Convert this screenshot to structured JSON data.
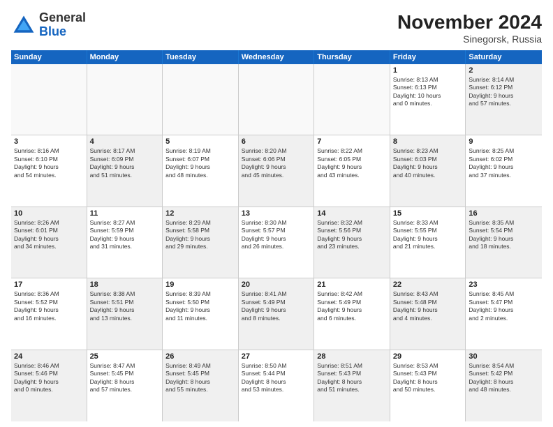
{
  "logo": {
    "general": "General",
    "blue": "Blue"
  },
  "title": "November 2024",
  "subtitle": "Sinegorsk, Russia",
  "header_days": [
    "Sunday",
    "Monday",
    "Tuesday",
    "Wednesday",
    "Thursday",
    "Friday",
    "Saturday"
  ],
  "rows": [
    [
      {
        "day": "",
        "empty": true
      },
      {
        "day": "",
        "empty": true
      },
      {
        "day": "",
        "empty": true
      },
      {
        "day": "",
        "empty": true
      },
      {
        "day": "",
        "empty": true
      },
      {
        "day": "1",
        "lines": [
          "Sunrise: 8:13 AM",
          "Sunset: 6:13 PM",
          "Daylight: 10 hours",
          "and 0 minutes."
        ]
      },
      {
        "day": "2",
        "shaded": true,
        "lines": [
          "Sunrise: 8:14 AM",
          "Sunset: 6:12 PM",
          "Daylight: 9 hours",
          "and 57 minutes."
        ]
      }
    ],
    [
      {
        "day": "3",
        "lines": [
          "Sunrise: 8:16 AM",
          "Sunset: 6:10 PM",
          "Daylight: 9 hours",
          "and 54 minutes."
        ]
      },
      {
        "day": "4",
        "shaded": true,
        "lines": [
          "Sunrise: 8:17 AM",
          "Sunset: 6:09 PM",
          "Daylight: 9 hours",
          "and 51 minutes."
        ]
      },
      {
        "day": "5",
        "lines": [
          "Sunrise: 8:19 AM",
          "Sunset: 6:07 PM",
          "Daylight: 9 hours",
          "and 48 minutes."
        ]
      },
      {
        "day": "6",
        "shaded": true,
        "lines": [
          "Sunrise: 8:20 AM",
          "Sunset: 6:06 PM",
          "Daylight: 9 hours",
          "and 45 minutes."
        ]
      },
      {
        "day": "7",
        "lines": [
          "Sunrise: 8:22 AM",
          "Sunset: 6:05 PM",
          "Daylight: 9 hours",
          "and 43 minutes."
        ]
      },
      {
        "day": "8",
        "shaded": true,
        "lines": [
          "Sunrise: 8:23 AM",
          "Sunset: 6:03 PM",
          "Daylight: 9 hours",
          "and 40 minutes."
        ]
      },
      {
        "day": "9",
        "lines": [
          "Sunrise: 8:25 AM",
          "Sunset: 6:02 PM",
          "Daylight: 9 hours",
          "and 37 minutes."
        ]
      }
    ],
    [
      {
        "day": "10",
        "shaded": true,
        "lines": [
          "Sunrise: 8:26 AM",
          "Sunset: 6:01 PM",
          "Daylight: 9 hours",
          "and 34 minutes."
        ]
      },
      {
        "day": "11",
        "lines": [
          "Sunrise: 8:27 AM",
          "Sunset: 5:59 PM",
          "Daylight: 9 hours",
          "and 31 minutes."
        ]
      },
      {
        "day": "12",
        "shaded": true,
        "lines": [
          "Sunrise: 8:29 AM",
          "Sunset: 5:58 PM",
          "Daylight: 9 hours",
          "and 29 minutes."
        ]
      },
      {
        "day": "13",
        "lines": [
          "Sunrise: 8:30 AM",
          "Sunset: 5:57 PM",
          "Daylight: 9 hours",
          "and 26 minutes."
        ]
      },
      {
        "day": "14",
        "shaded": true,
        "lines": [
          "Sunrise: 8:32 AM",
          "Sunset: 5:56 PM",
          "Daylight: 9 hours",
          "and 23 minutes."
        ]
      },
      {
        "day": "15",
        "lines": [
          "Sunrise: 8:33 AM",
          "Sunset: 5:55 PM",
          "Daylight: 9 hours",
          "and 21 minutes."
        ]
      },
      {
        "day": "16",
        "shaded": true,
        "lines": [
          "Sunrise: 8:35 AM",
          "Sunset: 5:54 PM",
          "Daylight: 9 hours",
          "and 18 minutes."
        ]
      }
    ],
    [
      {
        "day": "17",
        "lines": [
          "Sunrise: 8:36 AM",
          "Sunset: 5:52 PM",
          "Daylight: 9 hours",
          "and 16 minutes."
        ]
      },
      {
        "day": "18",
        "shaded": true,
        "lines": [
          "Sunrise: 8:38 AM",
          "Sunset: 5:51 PM",
          "Daylight: 9 hours",
          "and 13 minutes."
        ]
      },
      {
        "day": "19",
        "lines": [
          "Sunrise: 8:39 AM",
          "Sunset: 5:50 PM",
          "Daylight: 9 hours",
          "and 11 minutes."
        ]
      },
      {
        "day": "20",
        "shaded": true,
        "lines": [
          "Sunrise: 8:41 AM",
          "Sunset: 5:49 PM",
          "Daylight: 9 hours",
          "and 8 minutes."
        ]
      },
      {
        "day": "21",
        "lines": [
          "Sunrise: 8:42 AM",
          "Sunset: 5:49 PM",
          "Daylight: 9 hours",
          "and 6 minutes."
        ]
      },
      {
        "day": "22",
        "shaded": true,
        "lines": [
          "Sunrise: 8:43 AM",
          "Sunset: 5:48 PM",
          "Daylight: 9 hours",
          "and 4 minutes."
        ]
      },
      {
        "day": "23",
        "lines": [
          "Sunrise: 8:45 AM",
          "Sunset: 5:47 PM",
          "Daylight: 9 hours",
          "and 2 minutes."
        ]
      }
    ],
    [
      {
        "day": "24",
        "shaded": true,
        "lines": [
          "Sunrise: 8:46 AM",
          "Sunset: 5:46 PM",
          "Daylight: 9 hours",
          "and 0 minutes."
        ]
      },
      {
        "day": "25",
        "lines": [
          "Sunrise: 8:47 AM",
          "Sunset: 5:45 PM",
          "Daylight: 8 hours",
          "and 57 minutes."
        ]
      },
      {
        "day": "26",
        "shaded": true,
        "lines": [
          "Sunrise: 8:49 AM",
          "Sunset: 5:45 PM",
          "Daylight: 8 hours",
          "and 55 minutes."
        ]
      },
      {
        "day": "27",
        "lines": [
          "Sunrise: 8:50 AM",
          "Sunset: 5:44 PM",
          "Daylight: 8 hours",
          "and 53 minutes."
        ]
      },
      {
        "day": "28",
        "shaded": true,
        "lines": [
          "Sunrise: 8:51 AM",
          "Sunset: 5:43 PM",
          "Daylight: 8 hours",
          "and 51 minutes."
        ]
      },
      {
        "day": "29",
        "lines": [
          "Sunrise: 8:53 AM",
          "Sunset: 5:43 PM",
          "Daylight: 8 hours",
          "and 50 minutes."
        ]
      },
      {
        "day": "30",
        "shaded": true,
        "lines": [
          "Sunrise: 8:54 AM",
          "Sunset: 5:42 PM",
          "Daylight: 8 hours",
          "and 48 minutes."
        ]
      }
    ]
  ]
}
